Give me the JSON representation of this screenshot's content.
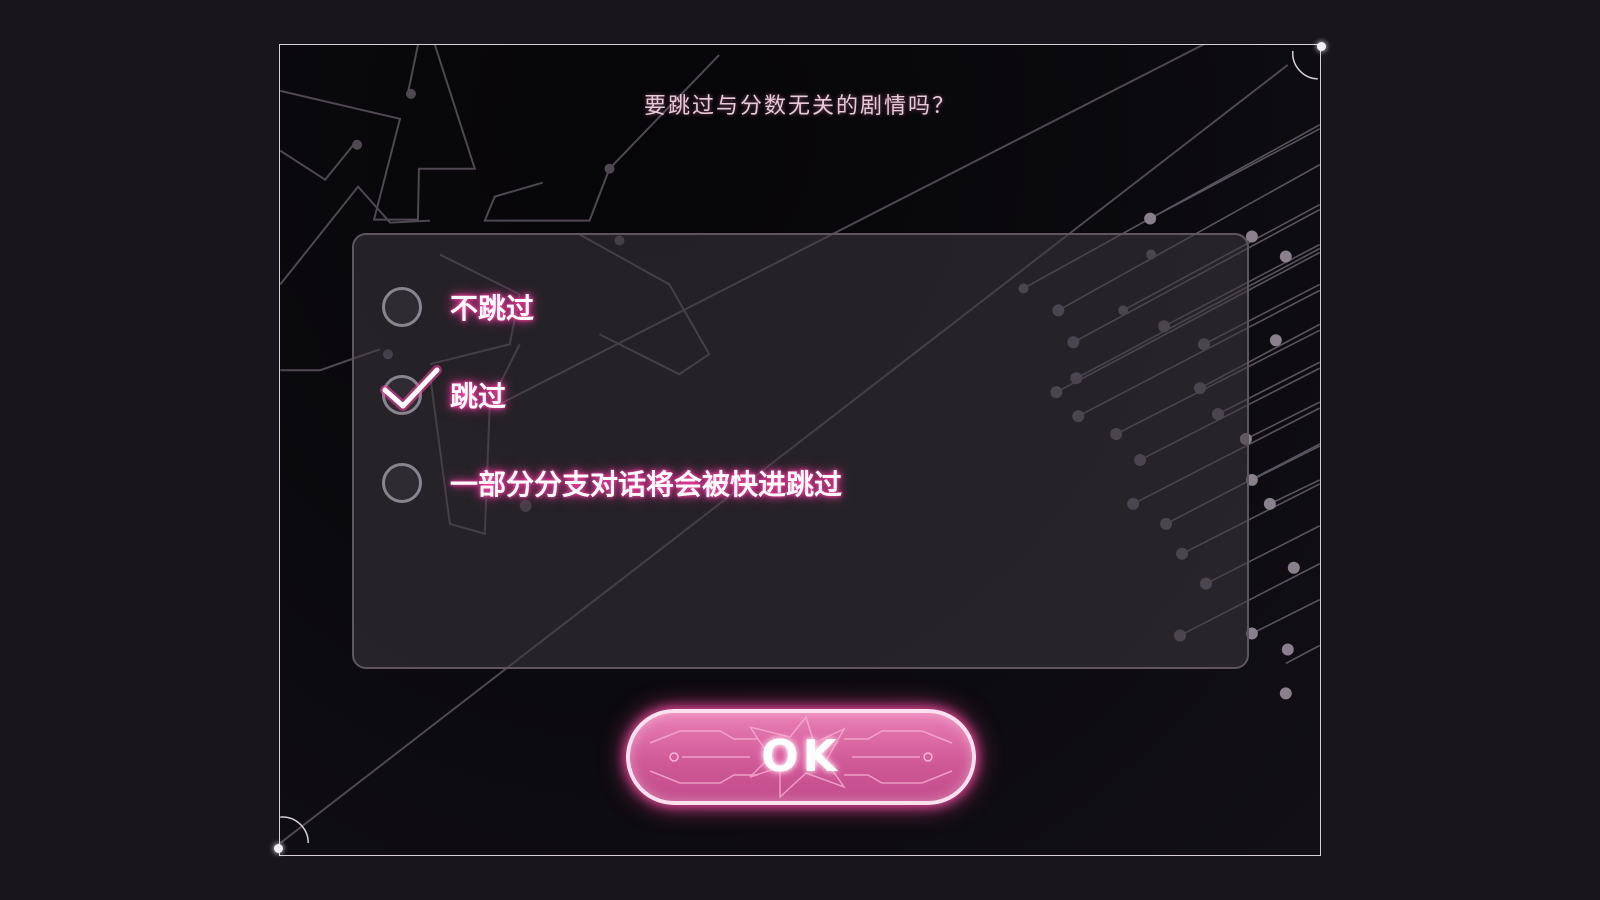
{
  "dialog": {
    "title": "要跳过与分数无关的剧情吗？"
  },
  "options": [
    {
      "label": "不跳过",
      "selected": false
    },
    {
      "label": "跳过",
      "selected": true
    },
    {
      "label": "一部分分支对话将会被快进跳过",
      "selected": false
    }
  ],
  "ok_button": {
    "label": "OK"
  },
  "colors": {
    "accent_pink": "#ff3ea8",
    "button_fill": "#d05a98",
    "frame": "#d9cfd8",
    "background": "#18161c"
  }
}
